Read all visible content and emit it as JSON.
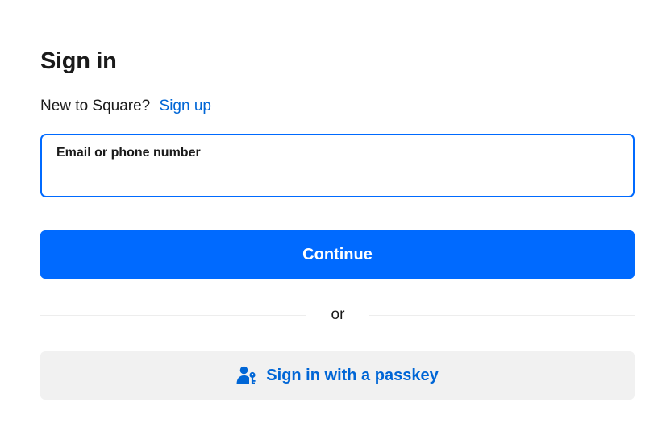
{
  "signin": {
    "title": "Sign in",
    "new_prompt": "New to Square?",
    "signup_link": "Sign up",
    "email_field": {
      "label": "Email or phone number",
      "value": "",
      "placeholder": ""
    },
    "continue_label": "Continue",
    "divider_text": "or",
    "passkey_label": "Sign in with a passkey",
    "passkey_icon": "user-key-icon"
  },
  "colors": {
    "accent": "#006aff",
    "link": "#0066d6",
    "secondary_bg": "#f1f1f1",
    "text": "#1a1a1a"
  }
}
